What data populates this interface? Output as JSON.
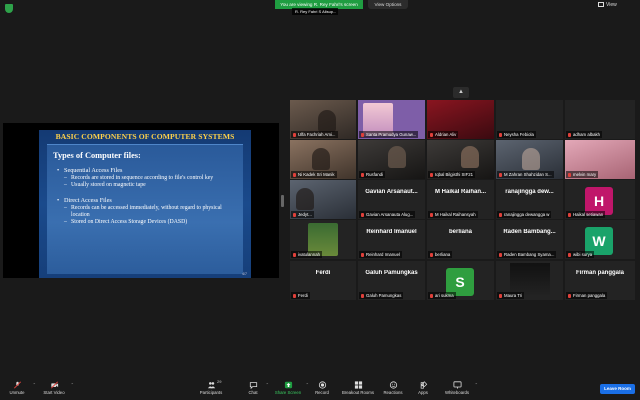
{
  "banner": {
    "share_text": "You are viewing R. Rey Fahri's screen",
    "view_options": "View Options",
    "speaker_name": "R. Rey Fahri S Alisup...",
    "view_label": "View"
  },
  "slide": {
    "title": "BASIC COMPONENTS OF COMPUTER SYSTEMS",
    "heading": "Types of Computer files:",
    "bullet1": "Sequential Access Files",
    "bullet1_sub1": "Records are stored in sequence according to file's control key",
    "bullet1_sub2": "Usually stored on magnetic tape",
    "bullet2": "Direct Access Files",
    "bullet2_sub1": "Records can be accessed immediately, without regard to physical location",
    "bullet2_sub2": "Stored on Direct Access Storage Devices (DASD)",
    "page_num": "4/7"
  },
  "gallery": {
    "row1": [
      "Ulfa Fachriah Ami...",
      "Santa Pramudya Gunaw...",
      "Aldrian Aliv",
      "Neysha Febiola",
      "adham albakh"
    ],
    "row2": [
      "Ni Kadek Sri Manik",
      "Rusfandi",
      "Iqbal Bilgisthi SIF21",
      "M Zahran Shahzidan S...",
      "melvin mary"
    ],
    "row3_big": [
      "",
      "Gavian Arsanaut...",
      "M Haikal Raihan...",
      "ranajingga dew...",
      ""
    ],
    "row3": [
      "Jedyt...",
      "Gavian Arsanauta Alug...",
      "M Haikal Raihansyah",
      "ranajingga dewangga w",
      "Haikal setiawan"
    ],
    "row4_big": [
      "",
      "Reinhard Imanuel",
      "berliana",
      "Raden Bambang...",
      ""
    ],
    "row4": [
      "ivatulannah",
      "Reinhard Imanuel",
      "berliana",
      "Raden Bambang Syama...",
      "wibi surya"
    ],
    "row5_big": [
      "Ferdi",
      "Galuh Pamungkas",
      "",
      "",
      "Firman panggala"
    ],
    "row5": [
      "Ferdi",
      "Galuh Pamungkas",
      "ari sukma",
      "Maura Tri",
      "Firman panggala"
    ],
    "avatars": {
      "haikal": {
        "letter": "H",
        "color": "#c0166a"
      },
      "wibi": {
        "letter": "W",
        "color": "#1aa36a"
      },
      "ari": {
        "letter": "S",
        "color": "#2f9e3f"
      }
    }
  },
  "toolbar": {
    "unmute": "Unmute",
    "start_video": "Start Video",
    "participants": "Participants",
    "participants_count": "29",
    "chat": "Chat",
    "share_screen": "Share Screen",
    "record": "Record",
    "breakout_rooms": "Breakout Rooms",
    "reactions": "Reactions",
    "apps": "Apps",
    "whiteboards": "Whiteboards",
    "leave": "Leave Room"
  },
  "colors": {
    "share_green": "#1f9d41",
    "leave_blue": "#1a6fe6",
    "slide_title": "#ffd24a",
    "muted_red": "#e0403a"
  }
}
